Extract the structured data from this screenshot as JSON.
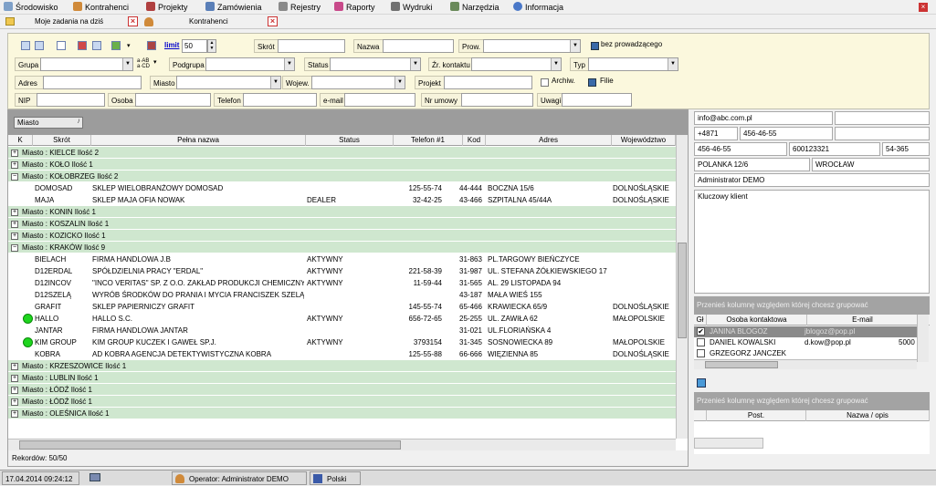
{
  "menu": {
    "items": [
      {
        "label": "Środowisko",
        "icon": "environment-icon"
      },
      {
        "label": "Kontrahenci",
        "icon": "contractor-icon"
      },
      {
        "label": "Projekty",
        "icon": "projects-icon"
      },
      {
        "label": "Zamówienia",
        "icon": "orders-icon"
      },
      {
        "label": "Rejestry",
        "icon": "registers-icon"
      },
      {
        "label": "Raporty",
        "icon": "reports-icon"
      },
      {
        "label": "Wydruki",
        "icon": "printer-icon"
      },
      {
        "label": "Narzędzia",
        "icon": "tools-icon"
      },
      {
        "label": "Informacja",
        "icon": "info-icon"
      }
    ]
  },
  "tabs": [
    {
      "label": "Moje zadania na dziś"
    },
    {
      "label": "Kontrahenci"
    }
  ],
  "filters": {
    "limit_label": "limit",
    "limit_value": "50",
    "skrot": "Skrót",
    "nazwa": "Nazwa",
    "prow": "Prow.",
    "bez_prowadzacego": "bez prowadzącego",
    "grupa": "Grupa",
    "podgrupa": "Podgrupa",
    "status": "Status",
    "zr_kontaktu": "Źr. kontaktu",
    "typ": "Typ",
    "adres": "Adres",
    "miasto": "Miasto",
    "wojew": "Wojew.",
    "projekt": "Projekt",
    "archiw": "Archiw.",
    "filie": "Filie",
    "nip": "NIP",
    "osoba": "Osoba",
    "telefon": "Telefon",
    "email": "e-mail",
    "nr_umowy": "Nr umowy",
    "uwagi": "Uwagi"
  },
  "grid": {
    "group_token": "Miasto",
    "columns": [
      "K",
      "Skrót",
      "Pełna nazwa",
      "Status",
      "Telefon #1",
      "Kod",
      "Adres",
      "Województwo"
    ],
    "rows": [
      {
        "group": true,
        "expanded": false,
        "text": "Miasto : KIELCE  Ilość 2"
      },
      {
        "group": true,
        "expanded": false,
        "text": "Miasto : KOŁO  Ilość 1"
      },
      {
        "group": true,
        "expanded": true,
        "text": "Miasto : KOŁOBRZEG  Ilość 2"
      },
      {
        "skrot": "DOMOSAD",
        "nazwa": "SKLEP WIELOBRANŻOWY DOMOSAD",
        "status": "",
        "tel": "125-55-74",
        "kod": "44-444",
        "adres": "BOCZNA  15/6",
        "woj": "DOLNOŚLĄSKIE"
      },
      {
        "skrot": "MAJA",
        "nazwa": "SKLEP MAJA OFIA NOWAK",
        "status": "DEALER",
        "tel": "32-42-25",
        "kod": "43-466",
        "adres": "SZPITALNA  45/44A",
        "woj": "DOLNOŚLĄSKIE"
      },
      {
        "group": true,
        "expanded": false,
        "text": "Miasto : KONIN  Ilość 1"
      },
      {
        "group": true,
        "expanded": false,
        "text": "Miasto : KOSZALIN  Ilość 1"
      },
      {
        "group": true,
        "expanded": false,
        "text": "Miasto : KOZICKO  Ilość 1"
      },
      {
        "group": true,
        "expanded": true,
        "text": "Miasto : KRAKÓW  Ilość 9"
      },
      {
        "skrot": "BIELACH",
        "nazwa": "FIRMA HANDLOWA J.B",
        "status": "AKTYWNY",
        "tel": "",
        "kod": "31-863",
        "adres": "PL.TARGOWY BIEŃCZYCE",
        "woj": ""
      },
      {
        "skrot": "D12ERDAL",
        "nazwa": "SPÓŁDZIELNIA PRACY \"ERDAL\"",
        "status": "AKTYWNY",
        "tel": "221-58-39",
        "kod": "31-987",
        "adres": "UL. STEFANA ŻÓŁKIEWSKIEGO 17",
        "woj": ""
      },
      {
        "skrot": "D12INCOV",
        "nazwa": "\"INCO VERITAS\" SP. Z O.O. ZAKŁAD PRODUKCJI CHEMICZNYCH",
        "status": "AKTYWNY",
        "tel": "11-59-44",
        "kod": "31-565",
        "adres": "AL. 29 LISTOPADA 94",
        "woj": ""
      },
      {
        "skrot": "D12SZELĄ",
        "nazwa": "WYRÓB ŚRODKÓW DO PRANIA I MYCIA FRANCISZEK SZELĄG",
        "status": "",
        "tel": "",
        "kod": "43-187",
        "adres": "MAŁA WIEŚ 155",
        "woj": ""
      },
      {
        "skrot": "GRAFIT",
        "nazwa": "SKLEP PAPIERNICZY GRAFIT",
        "status": "",
        "tel": "145-55-74",
        "kod": "65-466",
        "adres": "KRAWIECKA  65/9",
        "woj": "DOLNOŚLĄSKIE"
      },
      {
        "skrot": "HALLO",
        "nazwa": "HALLO S.C.",
        "status": "AKTYWNY",
        "tel": "656-72-65",
        "kod": "25-255",
        "adres": "UL. ZAWIŁA 62",
        "woj": "MAŁOPOLSKIE",
        "dot": true
      },
      {
        "skrot": "JANTAR",
        "nazwa": "FIRMA HANDLOWA JANTAR",
        "status": "",
        "tel": "",
        "kod": "31-021",
        "adres": "UL.FLORIAŃSKA 4",
        "woj": ""
      },
      {
        "skrot": "KIM GROUP",
        "nazwa": "KIM GROUP KUCZEK I GAWEŁ SP.J.",
        "status": "AKTYWNY",
        "tel": "3793154",
        "kod": "31-345",
        "adres": "SOSNOWIECKA 89",
        "woj": "MAŁOPOLSKIE",
        "dot": true
      },
      {
        "skrot": "KOBRA",
        "nazwa": "AD KOBRA AGENCJA DETEKTYWISTYCZNA KOBRA",
        "status": "",
        "tel": "125-55-88",
        "kod": "66-666",
        "adres": "WIĘZIENNA  85",
        "woj": "DOLNOŚLĄSKIE"
      },
      {
        "group": true,
        "expanded": false,
        "text": "Miasto : KRZESZOWICE  Ilość 1"
      },
      {
        "group": true,
        "expanded": false,
        "text": "Miasto : LUBLIN  Ilość 1"
      },
      {
        "group": true,
        "expanded": false,
        "text": "Miasto : ŁÓDŹ  Ilość 1"
      },
      {
        "group": true,
        "expanded": false,
        "text": "Miasto : ŁÓDŹ  Ilość 1"
      },
      {
        "group": true,
        "expanded": false,
        "text": "Miasto : OLEŚNICA  Ilość 1"
      }
    ],
    "records": "Rekordów: 50/50"
  },
  "details": {
    "email": "info@abc.com.pl",
    "phone_prefix": "+4871",
    "phone": "456-46-55",
    "fax": "456-46-55",
    "code1": "600123321",
    "code2": "54-365",
    "street": "POLANKA 12/6",
    "city": "WROCŁAW",
    "owner": "Administrator DEMO",
    "note": "Kluczowy klient",
    "contacts_grouphint": "Przenieś kolumnę względem której chcesz grupować",
    "contacts_columns": [
      "Gł",
      "Osoba kontaktowa",
      "E-mail"
    ],
    "contacts": [
      {
        "name": "JANINA BLOGOZ",
        "email": "jblogoz@pop.pl",
        "selected": true
      },
      {
        "name": "DANIEL KOWALSKI",
        "email": "d.kow@pop.pl",
        "extra": "5000"
      },
      {
        "name": "GRZEGORZ JANCZEK",
        "email": ""
      }
    ],
    "branches_grouphint": "Przenieś kolumnę względem której chcesz grupować",
    "branches_columns": [
      "Post.",
      "Nazwa / opis"
    ]
  },
  "taskbar": {
    "datetime": "17.04.2014 09:24:12",
    "operator": "Operator: Administrator DEMO",
    "lang": "Polski"
  }
}
